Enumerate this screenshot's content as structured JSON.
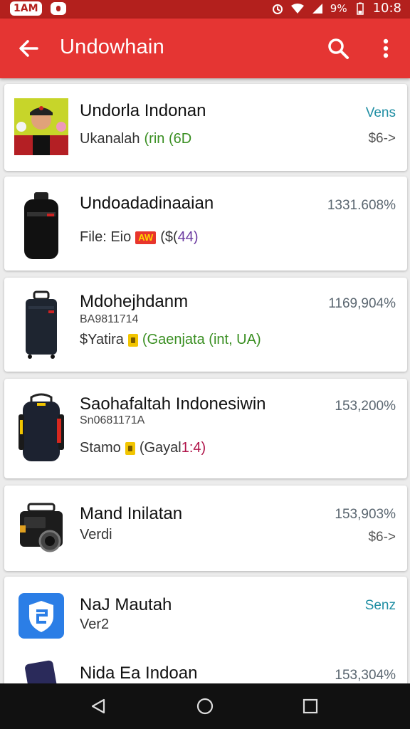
{
  "status_bar": {
    "left_badge": "1AM",
    "battery": "9%",
    "time": "10:8"
  },
  "app_bar": {
    "title": "Undowhain"
  },
  "items": [
    {
      "title": "Undorla Indonan",
      "detail_prefix": "Ukanalah ",
      "detail_accent": "(rin (6D",
      "right_top": "Vens",
      "right_bottom": "$6->"
    },
    {
      "title": "Undoadadinaaian",
      "detail_prefix": "File: Eio",
      "detail_tag": "AW",
      "detail_suffix_a": "($(",
      "detail_suffix_b": "44)",
      "right_top": "1331.608%"
    },
    {
      "title": "Mdohejhdanm",
      "subtitle": "BA9811714",
      "detail_prefix": "$Yatira",
      "detail_accent": "(Gaenjata (int, UA)",
      "right_top": "1169,904%"
    },
    {
      "title": "Saohafaltah Indonesiwin",
      "subtitle": "Sn0681171A",
      "detail_prefix": "Stamo",
      "detail_accent_a": "(Gayal ",
      "detail_accent_b": "1:4)",
      "right_top": "153,200%"
    },
    {
      "title": "Mand Inilatan",
      "subtitle": "Verdi",
      "right_top": "153,903%",
      "right_bottom": "$6->"
    },
    {
      "title": "NaJ Mautah",
      "subtitle": "Ver2",
      "right_top": "Senz"
    },
    {
      "title": "Nida Ea Indoan",
      "right_top": "153,304%"
    }
  ],
  "colors": {
    "status_bar": "#b3201d",
    "app_bar": "#e53533",
    "teal_accent": "#1f8ea3",
    "nav_bar": "#111111"
  },
  "icons": [
    "back-arrow-icon",
    "search-icon",
    "more-vert-icon",
    "alarm-icon",
    "wifi-icon",
    "signal-icon",
    "nav-back-icon",
    "nav-home-icon",
    "nav-recents-icon"
  ]
}
